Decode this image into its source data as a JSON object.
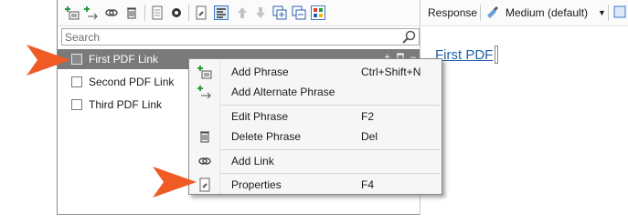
{
  "search": {
    "placeholder": "Search"
  },
  "links": [
    {
      "label": "First PDF Link",
      "selected": true
    },
    {
      "label": "Second PDF Link",
      "selected": false
    },
    {
      "label": "Third PDF Link",
      "selected": false
    }
  ],
  "right_toolbar": {
    "response_label": "Response",
    "medium_label": "Medium (default)"
  },
  "editor": {
    "link_text": "First PDF"
  },
  "context_menu": {
    "items": [
      {
        "label": "Add Phrase",
        "shortcut": "Ctrl+Shift+N"
      },
      {
        "label": "Add Alternate Phrase",
        "shortcut": ""
      },
      {
        "label": "Edit Phrase",
        "shortcut": "F2"
      },
      {
        "label": "Delete Phrase",
        "shortcut": "Del"
      },
      {
        "label": "Add Link",
        "shortcut": ""
      },
      {
        "label": "Properties",
        "shortcut": "F4"
      }
    ]
  },
  "colors": {
    "accent_arrow": "#f05a24",
    "selection": "#7a7a7a",
    "link": "#1f5fa8",
    "add_green": "#2e9a3a"
  }
}
